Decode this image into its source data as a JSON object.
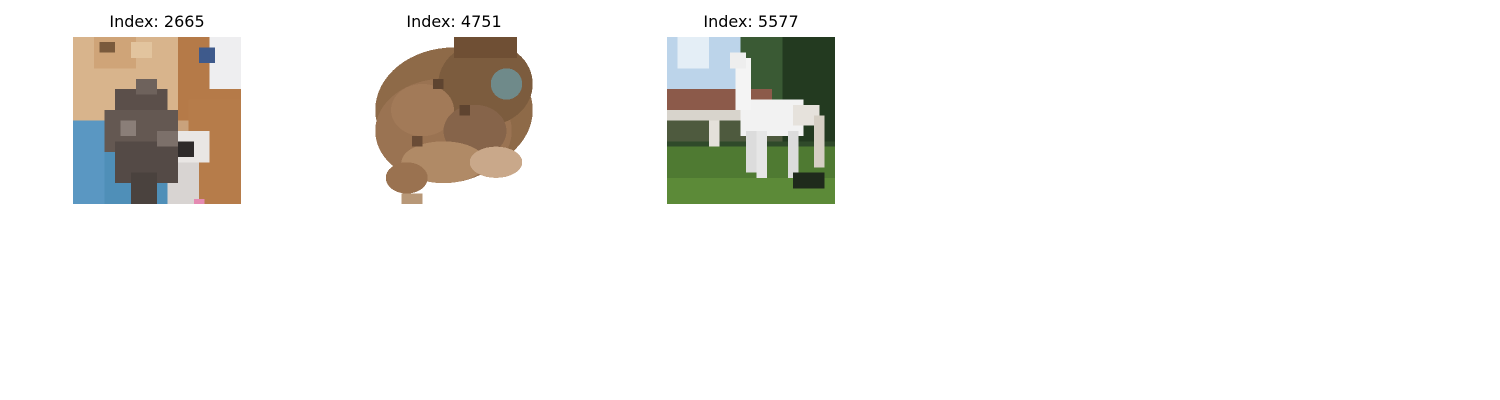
{
  "panels": [
    {
      "title": "Index: 2665",
      "subject": "cat"
    },
    {
      "title": "Index: 4751",
      "subject": "toad"
    },
    {
      "title": "Index: 5577",
      "subject": "horse"
    }
  ],
  "colors": {
    "background": "#ffffff",
    "text": "#000000"
  }
}
